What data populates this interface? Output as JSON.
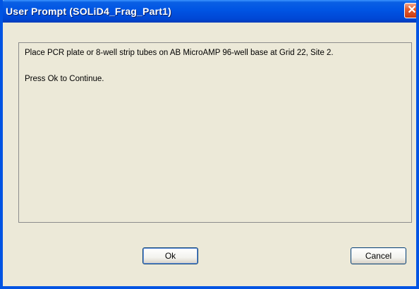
{
  "window": {
    "title": "User Prompt (SOLiD4_Frag_Part1)",
    "close_glyph": "✕"
  },
  "message": {
    "line1": "Place PCR plate or 8-well strip tubes on AB MicroAMP 96-well base at Grid 22, Site 2.",
    "line2": "Press Ok to Continue."
  },
  "buttons": {
    "ok_label": "Ok",
    "cancel_label": "Cancel"
  },
  "colors": {
    "titlebar": "#0054e3",
    "window_bg": "#ece9d8",
    "close_button": "#e35b2d"
  }
}
